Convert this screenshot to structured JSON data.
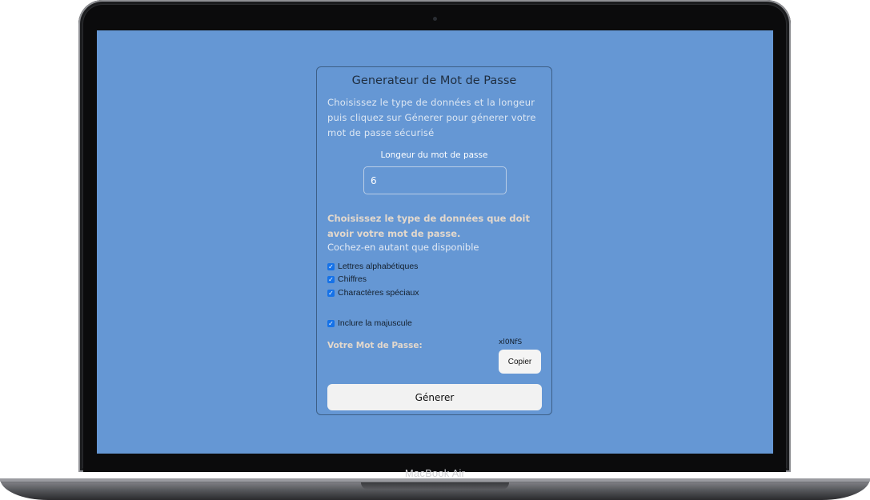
{
  "device": {
    "label": "MacBook Air"
  },
  "app": {
    "title": "Generateur de Mot de Passe",
    "intro": "Choisissez le type de données et la longeur puis cliquez sur Génerer pour génerer votre mot de passe sécurisé",
    "length_label": "Longeur du mot de passe",
    "length_value": "6",
    "types_heading": "Choisissez le type de données que doit avoir votre mot de passe.",
    "types_subheading": "Cochez-en autant que disponible",
    "checkboxes": [
      {
        "label": "Lettres alphabétiques",
        "checked": true
      },
      {
        "label": "Chiffres",
        "checked": true
      },
      {
        "label": "Charactères spéciaux",
        "checked": true
      }
    ],
    "uppercase": {
      "label": "Inclure la majuscule",
      "checked": true
    },
    "result_label": "Votre Mot de Passe:",
    "password": "xl0NfS",
    "copy_label": "Copier",
    "generate_label": "Génerer"
  },
  "colors": {
    "screen_background": "#6597d4",
    "checkbox_accent": "#1572e8"
  }
}
